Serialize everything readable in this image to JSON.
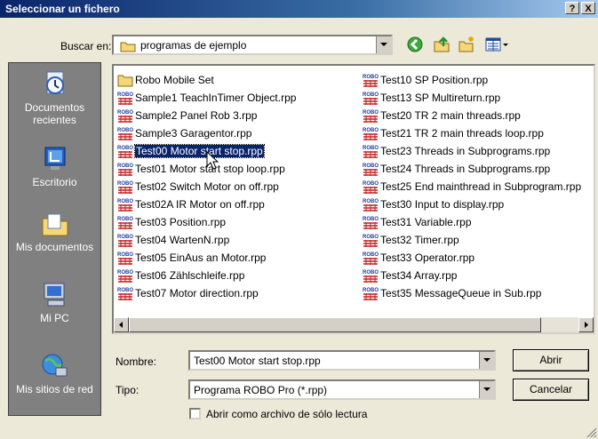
{
  "window": {
    "title": "Seleccionar un fichero",
    "help_glyph": "?",
    "close_glyph": "X"
  },
  "lookin": {
    "label": "Buscar en:",
    "value": "programas de ejemplo"
  },
  "places": [
    {
      "label": "Documentos recientes",
      "icon": "recent-documents-icon"
    },
    {
      "label": "Escritorio",
      "icon": "desktop-icon"
    },
    {
      "label": "Mis documentos",
      "icon": "my-documents-icon"
    },
    {
      "label": "Mi PC",
      "icon": "my-computer-icon"
    },
    {
      "label": "Mis sitios de red",
      "icon": "network-places-icon"
    }
  ],
  "files_col1": [
    {
      "name": "Robo Mobile Set",
      "type": "folder"
    },
    {
      "name": "Sample1 TeachInTimer Object.rpp",
      "type": "rpp"
    },
    {
      "name": "Sample2 Panel Rob 3.rpp",
      "type": "rpp"
    },
    {
      "name": "Sample3 Garagentor.rpp",
      "type": "rpp"
    },
    {
      "name": "Test00 Motor start stop.rpp",
      "type": "rpp",
      "selected": true
    },
    {
      "name": "Test01 Motor start stop loop.rpp",
      "type": "rpp"
    },
    {
      "name": "Test02 Switch Motor on off.rpp",
      "type": "rpp"
    },
    {
      "name": "Test02A IR Motor on off.rpp",
      "type": "rpp"
    },
    {
      "name": "Test03 Position.rpp",
      "type": "rpp"
    },
    {
      "name": "Test04 WartenN.rpp",
      "type": "rpp"
    },
    {
      "name": "Test05 EinAus an Motor.rpp",
      "type": "rpp"
    },
    {
      "name": "Test06 Zählschleife.rpp",
      "type": "rpp"
    },
    {
      "name": "Test07 Motor direction.rpp",
      "type": "rpp"
    }
  ],
  "files_col2": [
    {
      "name": "Test10 SP Position.rpp",
      "type": "rpp"
    },
    {
      "name": "Test13 SP Multireturn.rpp",
      "type": "rpp"
    },
    {
      "name": "Test20 TR 2 main threads.rpp",
      "type": "rpp"
    },
    {
      "name": "Test21 TR 2 main threads loop.rpp",
      "type": "rpp"
    },
    {
      "name": "Test23 Threads in Subprograms.rpp",
      "type": "rpp"
    },
    {
      "name": "Test24 Threads in Subprograms.rpp",
      "type": "rpp"
    },
    {
      "name": "Test25 End mainthread in Subprogram.rpp",
      "type": "rpp"
    },
    {
      "name": "Test30 Input to display.rpp",
      "type": "rpp"
    },
    {
      "name": "Test31 Variable.rpp",
      "type": "rpp"
    },
    {
      "name": "Test32 Timer.rpp",
      "type": "rpp"
    },
    {
      "name": "Test33 Operator.rpp",
      "type": "rpp"
    },
    {
      "name": "Test34 Array.rpp",
      "type": "rpp"
    },
    {
      "name": "Test35 MessageQueue in Sub.rpp",
      "type": "rpp"
    }
  ],
  "rpp_icon_text": "ROBO",
  "filename": {
    "label": "Nombre:",
    "value": "Test00 Motor start stop.rpp"
  },
  "filetype": {
    "label": "Tipo:",
    "value": "Programa ROBO Pro (*.rpp)"
  },
  "readonly": {
    "label": "Abrir como archivo de sólo lectura"
  },
  "buttons": {
    "open": "Abrir",
    "cancel": "Cancelar"
  }
}
